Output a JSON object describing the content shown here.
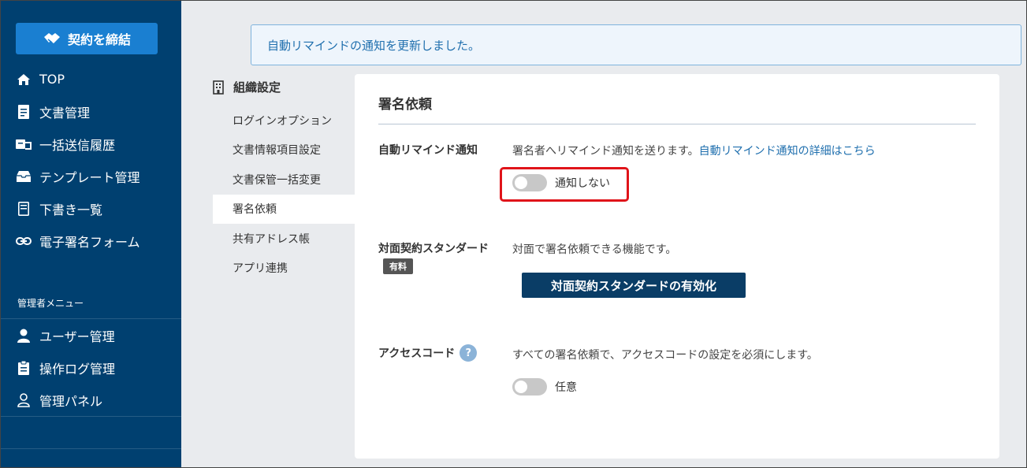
{
  "sidebar": {
    "cta_label": "契約を締結",
    "nav": [
      {
        "label": "TOP"
      },
      {
        "label": "文書管理"
      },
      {
        "label": "一括送信履歴"
      },
      {
        "label": "テンプレート管理"
      },
      {
        "label": "下書き一覧"
      },
      {
        "label": "電子署名フォーム"
      }
    ],
    "admin_title": "管理者メニュー",
    "admin_nav": [
      {
        "label": "ユーザー管理"
      },
      {
        "label": "操作ログ管理"
      },
      {
        "label": "管理パネル"
      }
    ]
  },
  "banner": {
    "message": "自動リマインドの通知を更新しました。"
  },
  "settings_nav": {
    "title": "組織設定",
    "items": [
      {
        "label": "ログインオプション"
      },
      {
        "label": "文書情報項目設定"
      },
      {
        "label": "文書保管一括変更"
      },
      {
        "label": "署名依頼"
      },
      {
        "label": "共有アドレス帳"
      },
      {
        "label": "アプリ連携"
      }
    ],
    "active": "署名依頼"
  },
  "panel": {
    "title": "署名依頼",
    "auto_remind": {
      "label": "自動リマインド通知",
      "description": "署名者へリマインド通知を送ります。",
      "link": "自動リマインド通知の詳細はこちら",
      "toggle_label": "通知しない"
    },
    "face_to_face": {
      "label": "対面契約スタンダード",
      "badge": "有料",
      "description": "対面で署名依頼できる機能です。",
      "button": "対面契約スタンダードの有効化"
    },
    "access_code": {
      "label": "アクセスコード",
      "help_symbol": "?",
      "description": "すべての署名依頼で、アクセスコードの設定を必須にします。",
      "toggle_label": "任意"
    }
  },
  "colors": {
    "sidebar_bg": "#004070",
    "cta_bg": "#1a7fd1",
    "link": "#1f6fae",
    "highlight": "#e0141a",
    "button_bg": "#0a3d66"
  }
}
